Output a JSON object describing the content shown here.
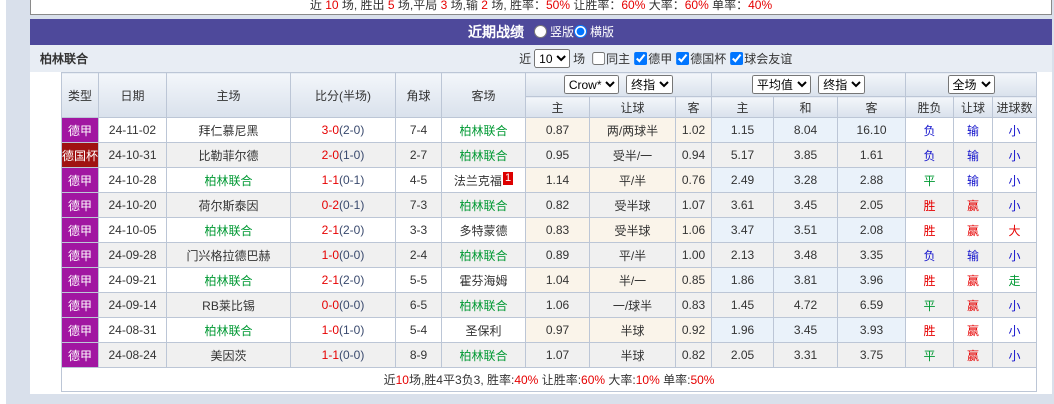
{
  "colors": {
    "title_bar_bg": "#4e499b",
    "result_red": "#e60000",
    "result_green": "#009933",
    "result_blue": "#1414cc",
    "half_score": "#3a4a6e",
    "crow_section_bg": "#faf4ea",
    "avg_section_bg": "#eaf2fa"
  },
  "top_summary": {
    "segments": [
      {
        "t": "近 ",
        "c": "k"
      },
      {
        "t": "10",
        "c": "r"
      },
      {
        "t": " 场, 胜出 ",
        "c": "k"
      },
      {
        "t": "5",
        "c": "r"
      },
      {
        "t": " 场,平局 ",
        "c": "k"
      },
      {
        "t": "3",
        "c": "r"
      },
      {
        "t": " 场,输 ",
        "c": "k"
      },
      {
        "t": "2",
        "c": "r"
      },
      {
        "t": " 场, 胜率：",
        "c": "k"
      },
      {
        "t": "50%",
        "c": "r"
      },
      {
        "t": " 让胜率：",
        "c": "k"
      },
      {
        "t": "60%",
        "c": "r"
      },
      {
        "t": " 大率：",
        "c": "k"
      },
      {
        "t": "60%",
        "c": "r"
      },
      {
        "t": " 单率：",
        "c": "k"
      },
      {
        "t": "40%",
        "c": "r"
      }
    ]
  },
  "title_bar": {
    "title": "近期战绩",
    "radios": [
      {
        "name": "vertical",
        "label": "竖版",
        "selected": false
      },
      {
        "name": "horizontal",
        "label": "横版",
        "selected": true
      }
    ]
  },
  "filter": {
    "team": "柏林联合",
    "prefix": "近",
    "count": "10",
    "suffix": "场",
    "checkboxes": [
      {
        "name": "same-home",
        "label": "同主",
        "checked": false
      },
      {
        "name": "bundesliga",
        "label": "德甲",
        "checked": true
      },
      {
        "name": "dfb-pokal",
        "label": "德国杯",
        "checked": true
      },
      {
        "name": "club-friendly",
        "label": "球会友谊",
        "checked": true
      }
    ]
  },
  "table": {
    "main_headers": [
      "类型",
      "日期",
      "主场",
      "比分(半场)",
      "角球",
      "客场"
    ],
    "group_selects": {
      "crow_source": "Crow*",
      "crow_stage": "终指",
      "avg_source": "平均值",
      "avg_stage": "终指",
      "scope": "全场"
    },
    "sub_headers": [
      "主",
      "让球",
      "客",
      "主",
      "和",
      "客",
      "胜负",
      "让球",
      "进球数"
    ],
    "league_colors": {
      "德甲": "#a116a1",
      "德国杯": "#a01212"
    },
    "result_colors": {
      "胜": "red",
      "平": "green",
      "负": "blue",
      "赢": "red",
      "输": "blue",
      "走": "green",
      "大": "red",
      "小": "blue"
    },
    "rows": [
      {
        "league": "德甲",
        "date": "24-11-02",
        "home": "拜仁慕尼黑",
        "home_green": false,
        "ft": "3-0",
        "ht": "(2-0)",
        "corner": "7-4",
        "away": "柏林联合",
        "away_green": true,
        "away_badge": "",
        "crow_home": "0.87",
        "handicap": "两/两球半",
        "crow_away": "1.02",
        "avg_home": "1.15",
        "avg_draw": "8.04",
        "avg_away": "16.10",
        "wdl": "负",
        "handicap_result": "输",
        "goals": "小"
      },
      {
        "league": "德国杯",
        "date": "24-10-31",
        "home": "比勒菲尔德",
        "home_green": false,
        "ft": "2-0",
        "ht": "(1-0)",
        "corner": "2-7",
        "away": "柏林联合",
        "away_green": true,
        "away_badge": "",
        "crow_home": "0.95",
        "handicap": "受半/一",
        "crow_away": "0.94",
        "avg_home": "5.17",
        "avg_draw": "3.85",
        "avg_away": "1.61",
        "wdl": "负",
        "handicap_result": "输",
        "goals": "小"
      },
      {
        "league": "德甲",
        "date": "24-10-28",
        "home": "柏林联合",
        "home_green": true,
        "ft": "1-1",
        "ht": "(0-1)",
        "corner": "4-5",
        "away": "法兰克福",
        "away_green": false,
        "away_badge": "1",
        "crow_home": "1.14",
        "handicap": "平/半",
        "crow_away": "0.76",
        "avg_home": "2.49",
        "avg_draw": "3.28",
        "avg_away": "2.88",
        "wdl": "平",
        "handicap_result": "输",
        "goals": "小"
      },
      {
        "league": "德甲",
        "date": "24-10-20",
        "home": "荷尔斯泰因",
        "home_green": false,
        "ft": "0-2",
        "ht": "(0-1)",
        "corner": "7-3",
        "away": "柏林联合",
        "away_green": true,
        "away_badge": "",
        "crow_home": "0.82",
        "handicap": "受半球",
        "crow_away": "1.07",
        "avg_home": "3.61",
        "avg_draw": "3.45",
        "avg_away": "2.05",
        "wdl": "胜",
        "handicap_result": "赢",
        "goals": "小"
      },
      {
        "league": "德甲",
        "date": "24-10-05",
        "home": "柏林联合",
        "home_green": true,
        "ft": "2-1",
        "ht": "(2-0)",
        "corner": "3-3",
        "away": "多特蒙德",
        "away_green": false,
        "away_badge": "",
        "crow_home": "0.83",
        "handicap": "受半球",
        "crow_away": "1.06",
        "avg_home": "3.47",
        "avg_draw": "3.51",
        "avg_away": "2.08",
        "wdl": "胜",
        "handicap_result": "赢",
        "goals": "大"
      },
      {
        "league": "德甲",
        "date": "24-09-28",
        "home": "门兴格拉德巴赫",
        "home_green": false,
        "ft": "1-0",
        "ht": "(0-0)",
        "corner": "2-4",
        "away": "柏林联合",
        "away_green": true,
        "away_badge": "",
        "crow_home": "0.89",
        "handicap": "平/半",
        "crow_away": "1.00",
        "avg_home": "2.13",
        "avg_draw": "3.48",
        "avg_away": "3.35",
        "wdl": "负",
        "handicap_result": "输",
        "goals": "小"
      },
      {
        "league": "德甲",
        "date": "24-09-21",
        "home": "柏林联合",
        "home_green": true,
        "ft": "2-1",
        "ht": "(2-0)",
        "corner": "5-5",
        "away": "霍芬海姆",
        "away_green": false,
        "away_badge": "",
        "crow_home": "1.04",
        "handicap": "半/一",
        "crow_away": "0.85",
        "avg_home": "1.86",
        "avg_draw": "3.81",
        "avg_away": "3.96",
        "wdl": "胜",
        "handicap_result": "赢",
        "goals": "走"
      },
      {
        "league": "德甲",
        "date": "24-09-14",
        "home": "RB莱比锡",
        "home_green": false,
        "ft": "0-0",
        "ht": "(0-0)",
        "corner": "6-5",
        "away": "柏林联合",
        "away_green": true,
        "away_badge": "",
        "crow_home": "1.06",
        "handicap": "一/球半",
        "crow_away": "0.83",
        "avg_home": "1.45",
        "avg_draw": "4.72",
        "avg_away": "6.59",
        "wdl": "平",
        "handicap_result": "赢",
        "goals": "小"
      },
      {
        "league": "德甲",
        "date": "24-08-31",
        "home": "柏林联合",
        "home_green": true,
        "ft": "1-0",
        "ht": "(1-0)",
        "corner": "5-4",
        "away": "圣保利",
        "away_green": false,
        "away_badge": "",
        "crow_home": "0.97",
        "handicap": "半球",
        "crow_away": "0.92",
        "avg_home": "1.96",
        "avg_draw": "3.45",
        "avg_away": "3.93",
        "wdl": "胜",
        "handicap_result": "赢",
        "goals": "小"
      },
      {
        "league": "德甲",
        "date": "24-08-24",
        "home": "美因茨",
        "home_green": false,
        "ft": "1-1",
        "ht": "(0-0)",
        "corner": "8-9",
        "away": "柏林联合",
        "away_green": true,
        "away_badge": "",
        "crow_home": "1.07",
        "handicap": "半球",
        "crow_away": "0.82",
        "avg_home": "2.05",
        "avg_draw": "3.31",
        "avg_away": "3.75",
        "wdl": "平",
        "handicap_result": "赢",
        "goals": "小"
      }
    ]
  },
  "footer": {
    "segments": [
      {
        "t": "近",
        "c": "k"
      },
      {
        "t": "10",
        "c": "r"
      },
      {
        "t": "场,胜4平3负3, 胜率:",
        "c": "k"
      },
      {
        "t": "40%",
        "c": "r"
      },
      {
        "t": " 让胜率:",
        "c": "k"
      },
      {
        "t": "60%",
        "c": "r"
      },
      {
        "t": " 大率:",
        "c": "k"
      },
      {
        "t": "10%",
        "c": "r"
      },
      {
        "t": " 单率:",
        "c": "k"
      },
      {
        "t": "50%",
        "c": "r"
      }
    ]
  }
}
